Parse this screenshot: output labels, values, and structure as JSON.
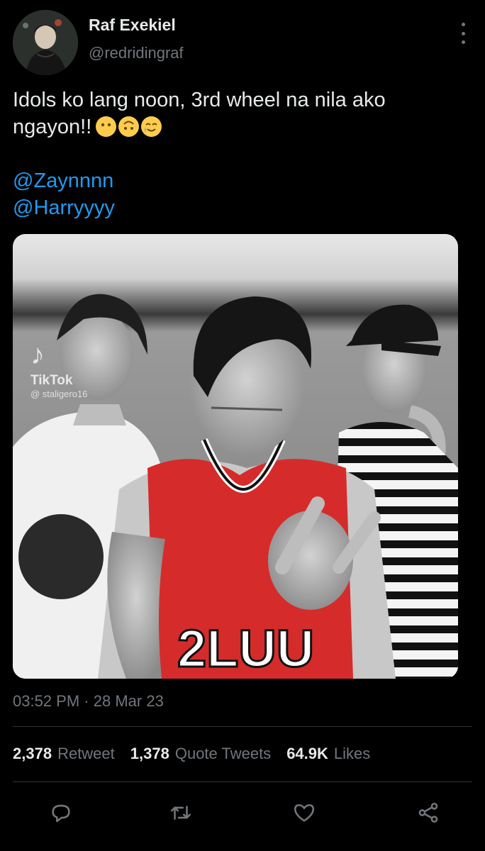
{
  "author": {
    "name": "Raf Exekiel",
    "handle": "@redridingraf"
  },
  "tweet": {
    "text": "Idols ko lang noon, 3rd wheel na nila ako ngayon!!",
    "emojis": [
      "no-mouth-face",
      "upside-down-face",
      "smiling-face-with-tear"
    ],
    "mentions": [
      "@Zaynnnn",
      "@Harryyyy"
    ]
  },
  "media": {
    "watermark_brand": "TikTok",
    "watermark_user": "@ staligero16",
    "jersey_text": "2LUU"
  },
  "meta": {
    "time": "03:52 PM",
    "separator": "·",
    "date": "28 Mar 23"
  },
  "stats": {
    "retweets": {
      "value": "2,378",
      "label": "Retweet"
    },
    "quotes": {
      "value": "1,378",
      "label": "Quote Tweets"
    },
    "likes": {
      "value": "64.9K",
      "label": "Likes"
    }
  },
  "actions": [
    "reply-icon",
    "retweet-icon",
    "like-icon",
    "share-icon"
  ],
  "colors": {
    "background": "#000000",
    "text": "#e7e9ea",
    "secondary": "#71767b",
    "link": "#1d9bf0",
    "divider": "#2f3336",
    "jersey_red": "#d62b2b"
  }
}
